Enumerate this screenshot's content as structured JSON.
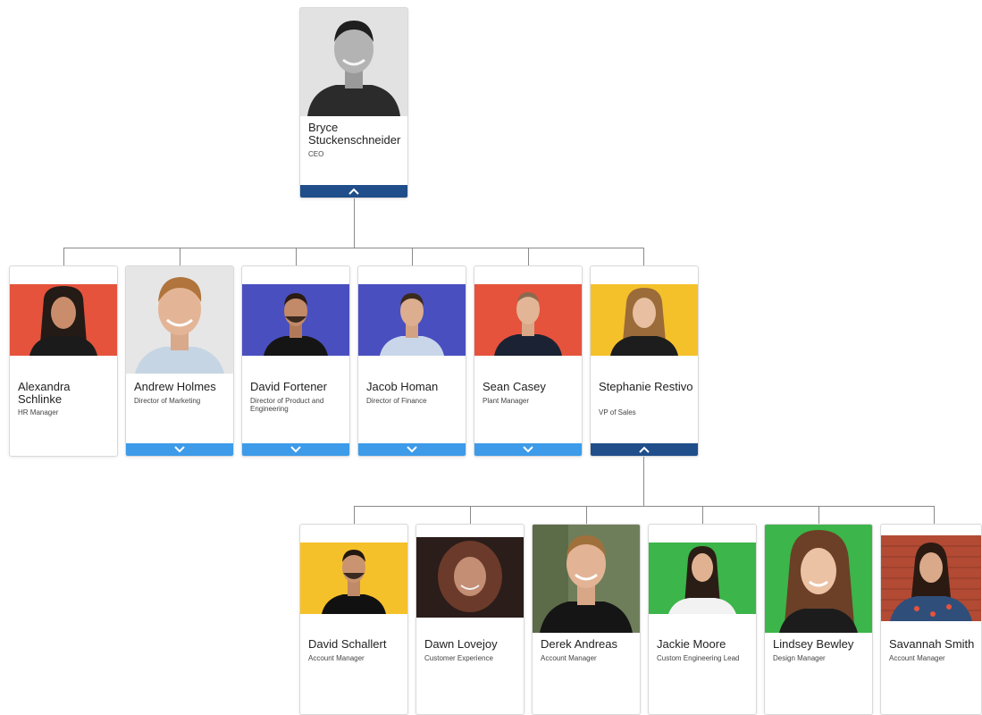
{
  "colors": {
    "red": "#e5533d",
    "indigo": "#4a4fbf",
    "yellow": "#f5c12b",
    "green": "#3cb54a",
    "collapse_bar": "#1f4e8a",
    "expand_bar": "#3d9be9",
    "connector": "#8a8a8a"
  },
  "ceo": {
    "name": "Bryce Stuckenschneider",
    "title": "CEO",
    "toggle_icon": "chevron-up-icon"
  },
  "directs": [
    {
      "name": "Alexandra Schlinke",
      "title": "HR Manager"
    },
    {
      "name": "Andrew Holmes",
      "title": "Director of Marketing",
      "toggle_icon": "chevron-down-icon"
    },
    {
      "name": "David Fortener",
      "title": "Director of Product and Engineering",
      "toggle_icon": "chevron-down-icon"
    },
    {
      "name": "Jacob Homan",
      "title": "Director of Finance",
      "toggle_icon": "chevron-down-icon"
    },
    {
      "name": "Sean Casey",
      "title": "Plant Manager",
      "toggle_icon": "chevron-down-icon"
    },
    {
      "name": "Stephanie Restivo",
      "title": "VP of Sales",
      "toggle_icon": "chevron-up-icon"
    }
  ],
  "sales_team": [
    {
      "name": "David Schallert",
      "title": "Account Manager"
    },
    {
      "name": "Dawn Lovejoy",
      "title": "Customer Experience"
    },
    {
      "name": "Derek Andreas",
      "title": "Account Manager"
    },
    {
      "name": "Jackie Moore",
      "title": "Custom Engineering Lead"
    },
    {
      "name": "Lindsey Bewley",
      "title": "Design Manager"
    },
    {
      "name": "Savannah Smith",
      "title": "Account Manager"
    }
  ]
}
